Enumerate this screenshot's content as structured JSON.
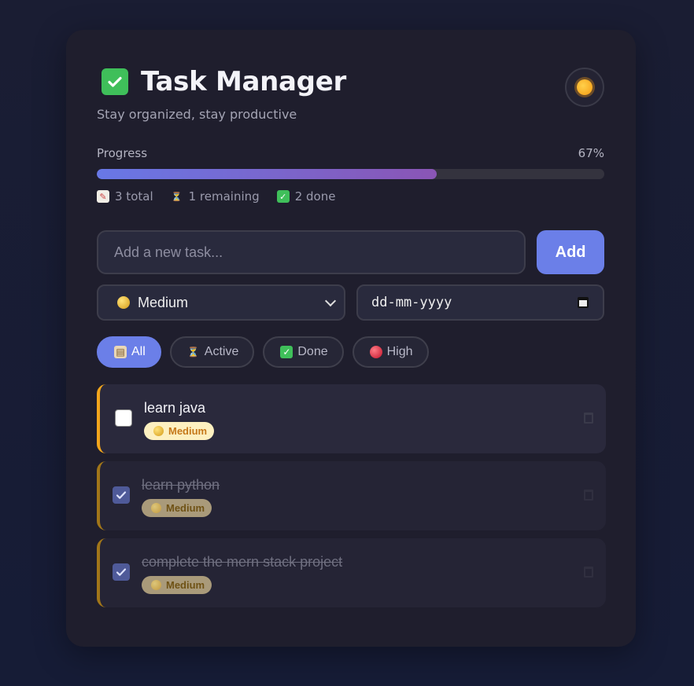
{
  "header": {
    "title": "Task Manager",
    "subtitle": "Stay organized, stay productive",
    "title_icon": "check-mark-button-icon",
    "theme_icon": "sun-icon"
  },
  "progress": {
    "label": "Progress",
    "percent_text": "67%",
    "fraction": 0.67,
    "stats": {
      "total": "3 total",
      "remaining": "1 remaining",
      "done": "2 done"
    }
  },
  "add_form": {
    "placeholder": "Add a new task...",
    "add_label": "Add",
    "priority_selected": "Medium",
    "date_placeholder": "dd-mm-yyyy"
  },
  "filters": [
    {
      "label": "All",
      "active": true
    },
    {
      "label": "Active",
      "active": false
    },
    {
      "label": "Done",
      "active": false
    },
    {
      "label": "High",
      "active": false
    }
  ],
  "tasks": [
    {
      "text": "learn java",
      "priority": "Medium",
      "done": false
    },
    {
      "text": "learn python",
      "priority": "Medium",
      "done": true
    },
    {
      "text": "complete the mern stack project",
      "priority": "Medium",
      "done": true
    }
  ],
  "colors": {
    "accent": "#6b7fe8",
    "medium_priority": "#f2a51c",
    "card_bg": "#1f1e2d"
  }
}
